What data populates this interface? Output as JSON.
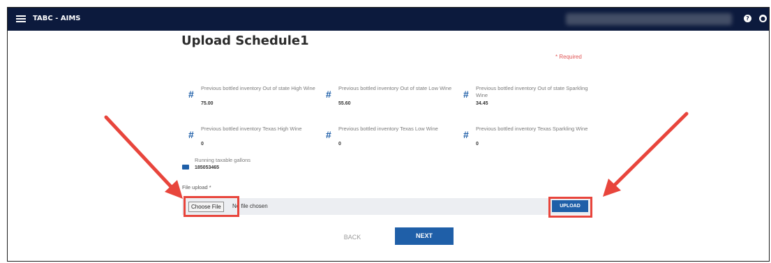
{
  "app": {
    "title": "TABC - AIMS"
  },
  "page": {
    "title": "Upload Schedule1",
    "required_note": "* Required"
  },
  "fields": [
    {
      "label": "Previous bottled inventory Out of state High Wine",
      "value": "75.00"
    },
    {
      "label": "Previous bottled inventory Out of state Low Wine",
      "value": "55.60"
    },
    {
      "label": "Previous bottled inventory Out of state Sparkling Wine",
      "value": "34.45"
    },
    {
      "label": "Previous bottled inventory Texas High Wine",
      "value": "0"
    },
    {
      "label": "Previous bottled inventory Texas Low Wine",
      "value": "0"
    },
    {
      "label": "Previous bottled inventory Texas Sparkling Wine",
      "value": "0"
    }
  ],
  "running": {
    "label": "Running taxable gallons",
    "value": "185053465"
  },
  "upload": {
    "label": "File upload *",
    "choose_label": "Choose File",
    "no_file_text": "No file chosen",
    "upload_label": "UPLOAD"
  },
  "nav": {
    "back_label": "BACK",
    "next_label": "NEXT"
  },
  "colors": {
    "topbar": "#0c1a3d",
    "primary": "#1f5fa8",
    "required": "#e05454",
    "annotation": "#e8453c"
  },
  "icons": {
    "menu": "hamburger-icon",
    "help": "help-icon",
    "account": "account-icon",
    "field": "hash-icon",
    "running": "box-icon"
  }
}
